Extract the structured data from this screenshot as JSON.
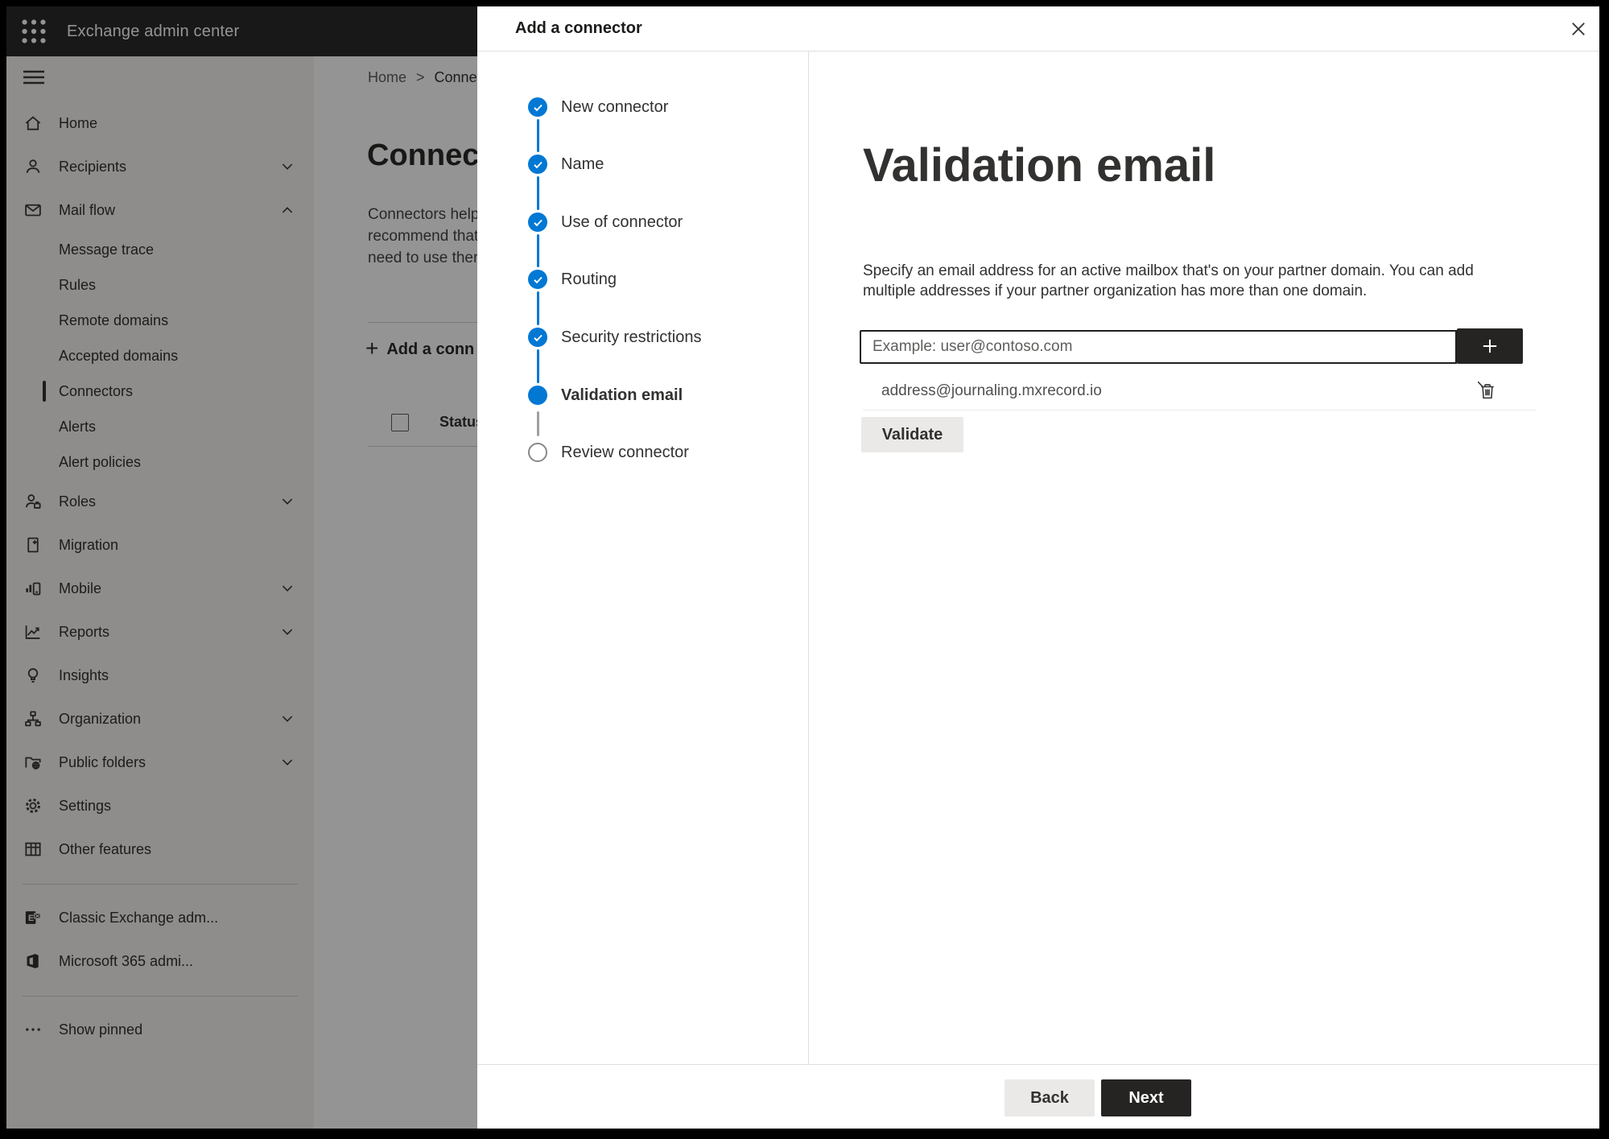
{
  "colors": {
    "accent_blue": "#0078d4",
    "dark_button": "#252423",
    "light_button": "#ebe9e7",
    "header_bg": "#2a2a2a",
    "step_upcoming_gray": "#8a8886"
  },
  "header": {
    "app_title": "Exchange admin center",
    "waffle_icon": "app-launcher-icon"
  },
  "sidebar": {
    "hamburger_icon": "hamburger-icon",
    "items": [
      {
        "label": "Home",
        "icon": "home-icon",
        "level": 1
      },
      {
        "label": "Recipients",
        "icon": "recipients-icon",
        "level": 1,
        "chevron": "down"
      },
      {
        "label": "Mail flow",
        "icon": "mail-flow-icon",
        "level": 1,
        "chevron": "up"
      },
      {
        "label": "Message trace",
        "level": 2
      },
      {
        "label": "Rules",
        "level": 2
      },
      {
        "label": "Remote domains",
        "level": 2
      },
      {
        "label": "Accepted domains",
        "level": 2
      },
      {
        "label": "Connectors",
        "level": 2,
        "selected": true
      },
      {
        "label": "Alerts",
        "level": 2
      },
      {
        "label": "Alert policies",
        "level": 2
      },
      {
        "label": "Roles",
        "icon": "roles-icon",
        "level": 1,
        "chevron": "down"
      },
      {
        "label": "Migration",
        "icon": "migration-icon",
        "level": 1
      },
      {
        "label": "Mobile",
        "icon": "mobile-icon",
        "level": 1,
        "chevron": "down"
      },
      {
        "label": "Reports",
        "icon": "reports-icon",
        "level": 1,
        "chevron": "down"
      },
      {
        "label": "Insights",
        "icon": "insights-icon",
        "level": 1
      },
      {
        "label": "Organization",
        "icon": "organization-icon",
        "level": 1,
        "chevron": "down"
      },
      {
        "label": "Public folders",
        "icon": "public-folders-icon",
        "level": 1,
        "chevron": "down"
      },
      {
        "label": "Settings",
        "icon": "settings-icon",
        "level": 1
      },
      {
        "label": "Other features",
        "icon": "other-features-icon",
        "level": 1
      },
      {
        "divider": true
      },
      {
        "label": "Classic Exchange adm...",
        "icon": "classic-exchange-icon",
        "level": 1
      },
      {
        "label": "Microsoft 365 admi...",
        "icon": "microsoft-365-icon",
        "level": 1
      },
      {
        "divider": true
      },
      {
        "label": "Show pinned",
        "icon": "more-dots-icon",
        "level": 1
      }
    ]
  },
  "background_page": {
    "breadcrumb": {
      "home": "Home",
      "separator": ">",
      "current": "Conne"
    },
    "heading": "Connec",
    "intro_lines": [
      "Connectors help",
      "recommend that",
      "need to use ther"
    ],
    "add_connector_label": "Add a conn",
    "add_connector_plus": "+",
    "table_header_status": "Status"
  },
  "panel": {
    "title": "Add a connector",
    "close_icon": "close-icon",
    "steps": [
      {
        "label": "New connector",
        "state": "completed"
      },
      {
        "label": "Name",
        "state": "completed"
      },
      {
        "label": "Use of connector",
        "state": "completed"
      },
      {
        "label": "Routing",
        "state": "completed"
      },
      {
        "label": "Security restrictions",
        "state": "completed"
      },
      {
        "label": "Validation email",
        "state": "current"
      },
      {
        "label": "Review connector",
        "state": "upcoming"
      }
    ],
    "content": {
      "heading": "Validation email",
      "description_lines": [
        "Specify an email address for an active mailbox that's on your partner domain. You can add",
        "multiple addresses if your partner organization has more than one domain."
      ],
      "email_input_placeholder": "Example: user@contoso.com",
      "addresses": [
        "address@journaling.mxrecord.io"
      ],
      "validate_label": "Validate"
    },
    "footer": {
      "back_label": "Back",
      "next_label": "Next"
    }
  }
}
